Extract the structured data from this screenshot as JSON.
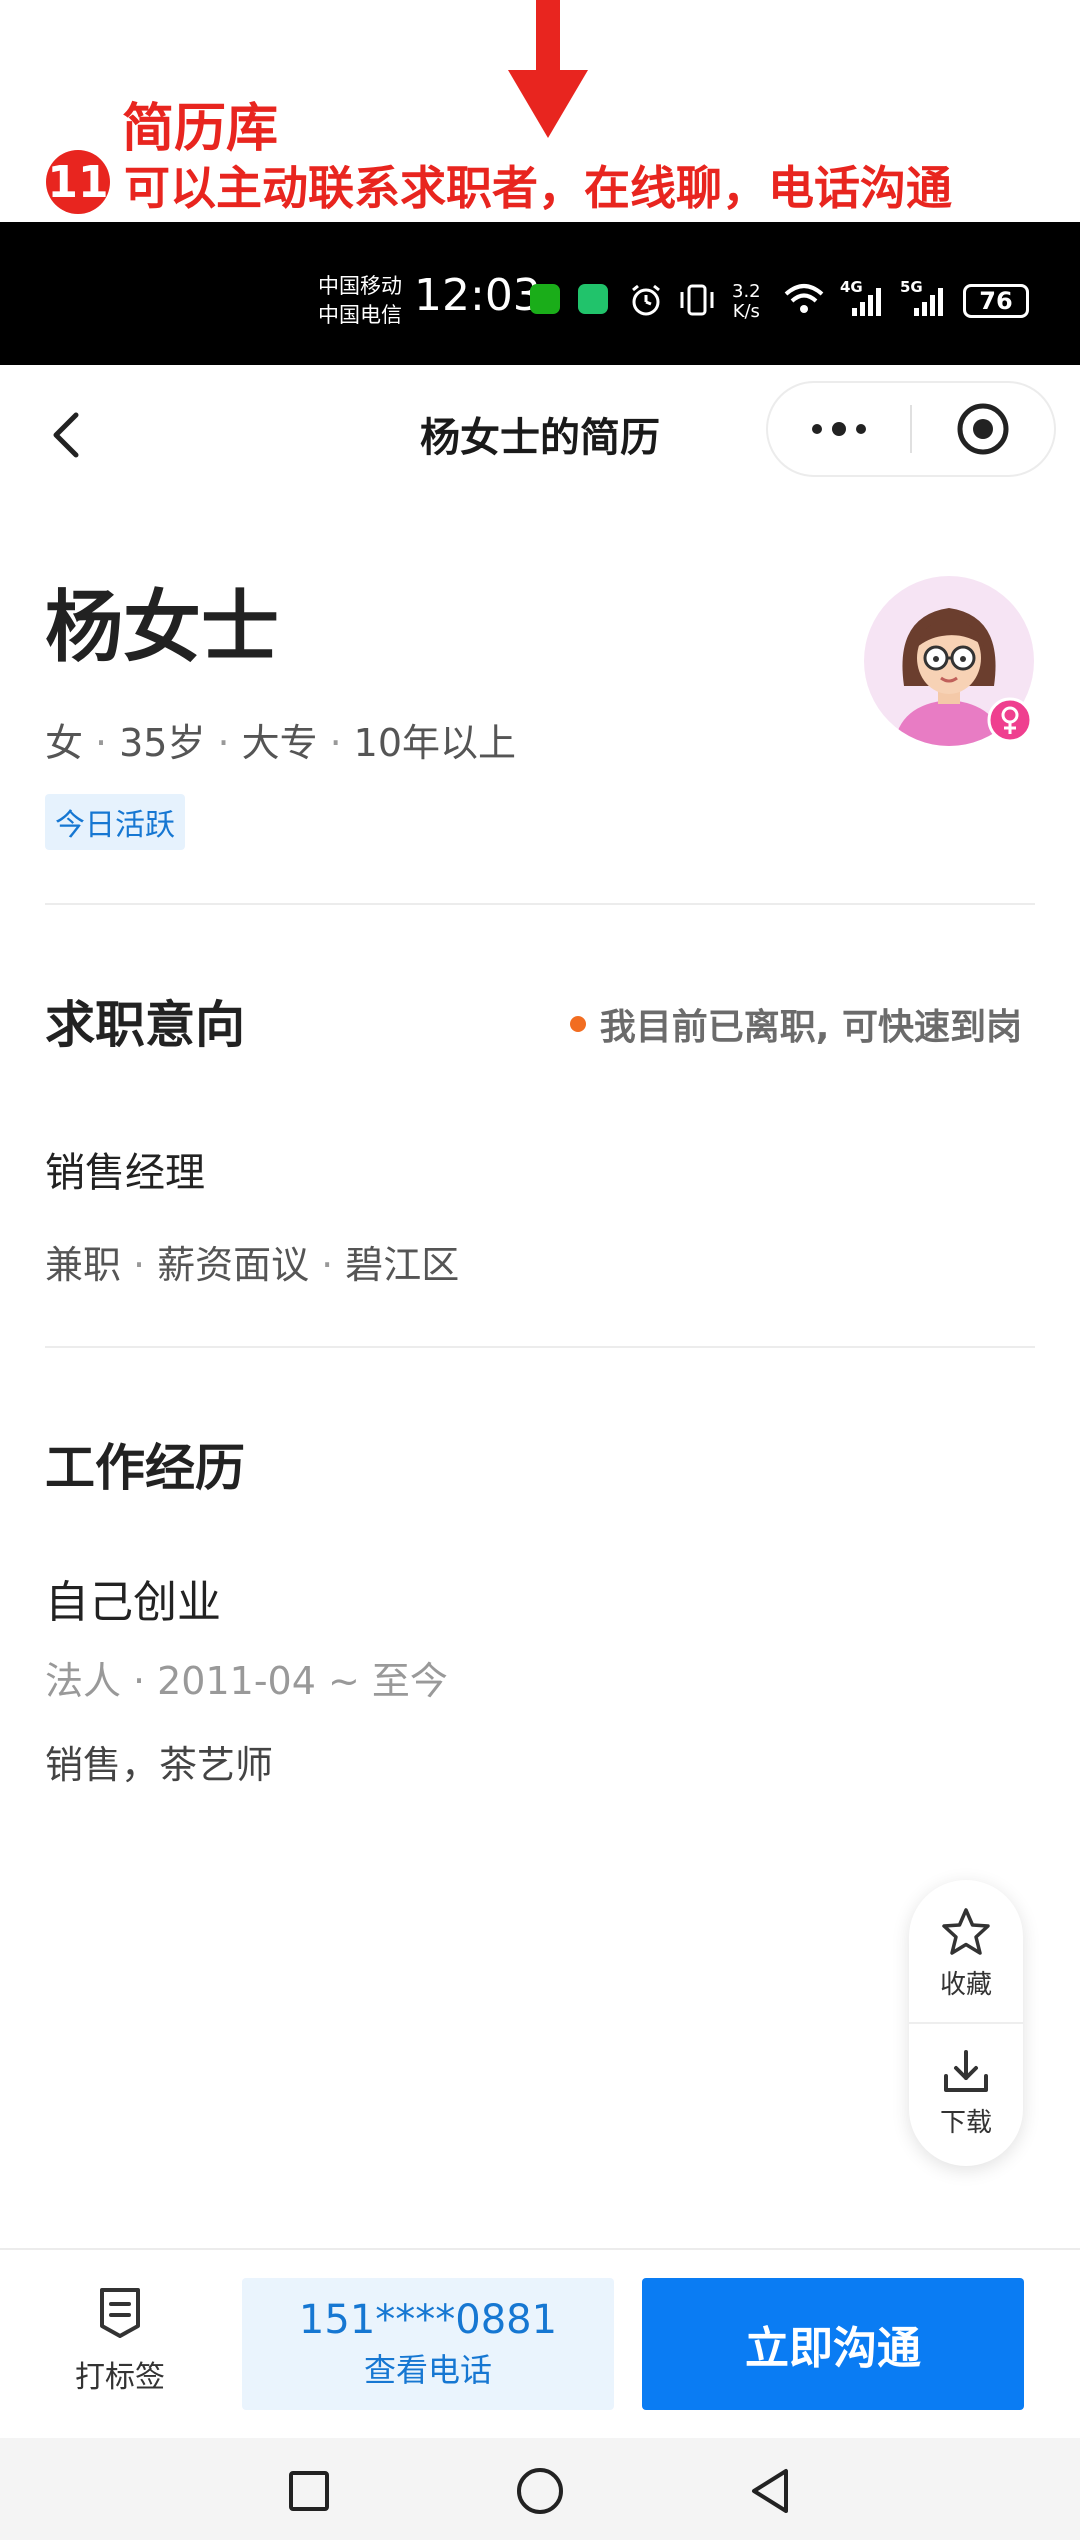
{
  "annotation": {
    "title": "简历库",
    "number": "11",
    "text": "可以主动联系求职者，在线聊，电话沟通",
    "color": "#e8251f"
  },
  "status_bar": {
    "carrier1": "中国移动",
    "carrier2": "中国电信",
    "time": "12:03",
    "speed_value": "3.2",
    "speed_unit": "K/s",
    "net1": "4G",
    "net2": "5G",
    "battery": "76"
  },
  "nav": {
    "title": "杨女士的简历"
  },
  "profile": {
    "name": "杨女士",
    "gender": "女",
    "age": "35岁",
    "education": "大专",
    "experience": "10年以上",
    "active_tag": "今日活跃",
    "avatar_icon": "female-avatar-icon"
  },
  "intention": {
    "title": "求职意向",
    "status": "我目前已离职, 可快速到岗",
    "status_color": "#f26d21",
    "job": "销售经理",
    "type": "兼职",
    "salary": "薪资面议",
    "location": "碧江区"
  },
  "experience": {
    "title": "工作经历",
    "company": "自己创业",
    "role": "法人",
    "period": "2011-04 ~ 至今",
    "description": "销售，茶艺师"
  },
  "float_actions": {
    "favorite": "收藏",
    "download": "下载"
  },
  "bottom": {
    "tag_label": "打标签",
    "phone_masked": "151****0881",
    "phone_label": "查看电话",
    "chat_label": "立即沟通",
    "accent": "#0a7cf3"
  }
}
